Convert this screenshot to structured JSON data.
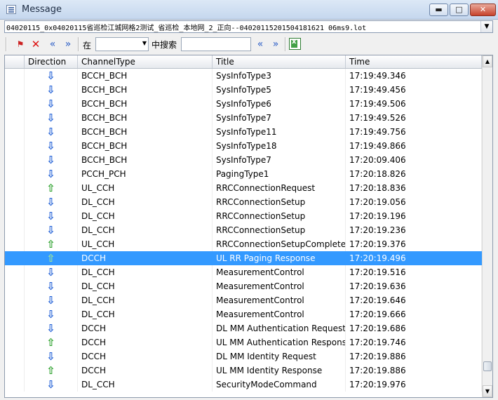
{
  "window": {
    "title": "Message",
    "min_glyph": "▬",
    "max_glyph": "□",
    "close_glyph": "✕"
  },
  "path": "04020115_0x04020115省巡检江城网格2测试_省巡检_本地网_2_正向--04020115201504181621 06ms9.lot",
  "toolbar": {
    "in_label": "在",
    "search_label": "中搜索",
    "search_value": "",
    "select_value": ""
  },
  "icons": {
    "flag": "flag-icon",
    "delete": "close-icon",
    "prev": "double-left-arrow-icon",
    "next": "double-right-arrow-icon",
    "export": "excel-icon",
    "direction_down": "arrow-down-icon",
    "direction_up": "arrow-up-icon"
  },
  "colors": {
    "selection": "#3399ff",
    "down_arrow": "#1f5fd6",
    "up_arrow": "#2da12d"
  },
  "table": {
    "columns": [
      "Direction",
      "ChannelType",
      "Title",
      "Time"
    ],
    "rows": [
      {
        "dir": "down",
        "channel": "BCCH_BCH",
        "title": "SysInfoType3",
        "time": "17:19:49.346"
      },
      {
        "dir": "down",
        "channel": "BCCH_BCH",
        "title": "SysInfoType5",
        "time": "17:19:49.456"
      },
      {
        "dir": "down",
        "channel": "BCCH_BCH",
        "title": "SysInfoType6",
        "time": "17:19:49.506"
      },
      {
        "dir": "down",
        "channel": "BCCH_BCH",
        "title": "SysInfoType7",
        "time": "17:19:49.526"
      },
      {
        "dir": "down",
        "channel": "BCCH_BCH",
        "title": "SysInfoType11",
        "time": "17:19:49.756"
      },
      {
        "dir": "down",
        "channel": "BCCH_BCH",
        "title": "SysInfoType18",
        "time": "17:19:49.866"
      },
      {
        "dir": "down",
        "channel": "BCCH_BCH",
        "title": "SysInfoType7",
        "time": "17:20:09.406"
      },
      {
        "dir": "down",
        "channel": "PCCH_PCH",
        "title": "PagingType1",
        "time": "17:20:18.826"
      },
      {
        "dir": "up",
        "channel": "UL_CCH",
        "title": "RRCConnectionRequest",
        "time": "17:20:18.836"
      },
      {
        "dir": "down",
        "channel": "DL_CCH",
        "title": "RRCConnectionSetup",
        "time": "17:20:19.056"
      },
      {
        "dir": "down",
        "channel": "DL_CCH",
        "title": "RRCConnectionSetup",
        "time": "17:20:19.196"
      },
      {
        "dir": "down",
        "channel": "DL_CCH",
        "title": "RRCConnectionSetup",
        "time": "17:20:19.236"
      },
      {
        "dir": "up",
        "channel": "UL_CCH",
        "title": "RRCConnectionSetupComplete",
        "time": "17:20:19.376"
      },
      {
        "dir": "up",
        "channel": "DCCH",
        "title": "UL RR Paging Response",
        "time": "17:20:19.496",
        "selected": true
      },
      {
        "dir": "down",
        "channel": "DL_CCH",
        "title": "MeasurementControl",
        "time": "17:20:19.516"
      },
      {
        "dir": "down",
        "channel": "DL_CCH",
        "title": "MeasurementControl",
        "time": "17:20:19.636"
      },
      {
        "dir": "down",
        "channel": "DL_CCH",
        "title": "MeasurementControl",
        "time": "17:20:19.646"
      },
      {
        "dir": "down",
        "channel": "DL_CCH",
        "title": "MeasurementControl",
        "time": "17:20:19.666"
      },
      {
        "dir": "down",
        "channel": "DCCH",
        "title": "DL MM Authentication Request",
        "time": "17:20:19.686"
      },
      {
        "dir": "up",
        "channel": "DCCH",
        "title": "UL MM Authentication Response",
        "time": "17:20:19.746"
      },
      {
        "dir": "down",
        "channel": "DCCH",
        "title": "DL MM Identity Request",
        "time": "17:20:19.886"
      },
      {
        "dir": "up",
        "channel": "DCCH",
        "title": "UL MM Identity Response",
        "time": "17:20:19.886"
      },
      {
        "dir": "down",
        "channel": "DL_CCH",
        "title": "SecurityModeCommand",
        "time": "17:20:19.976"
      }
    ]
  }
}
